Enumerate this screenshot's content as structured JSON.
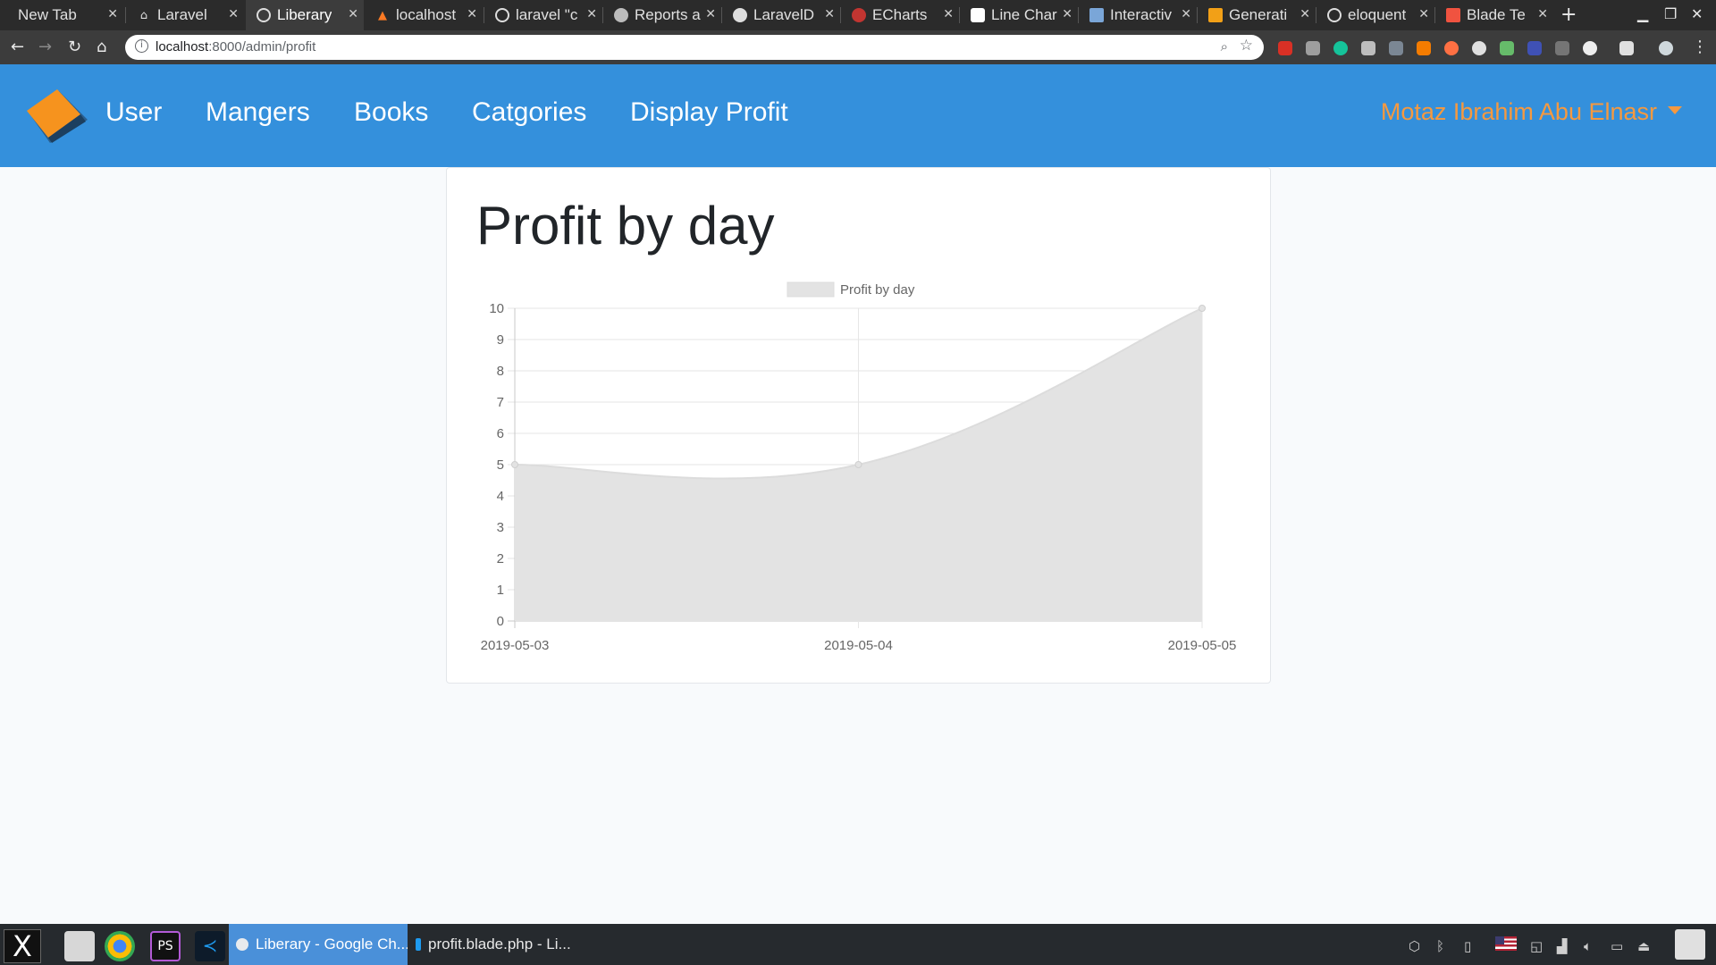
{
  "browser": {
    "tabs": [
      {
        "title": "New Tab",
        "icon": "blank-tab-icon"
      },
      {
        "title": "Laravel",
        "icon": "home-icon"
      },
      {
        "title": "Liberary",
        "icon": "globe-icon",
        "active": true
      },
      {
        "title": "localhost",
        "icon": "xampp-icon"
      },
      {
        "title": "laravel \"c",
        "icon": "google-icon"
      },
      {
        "title": "Reports a",
        "icon": "reports-icon"
      },
      {
        "title": "LaravelD",
        "icon": "github-icon"
      },
      {
        "title": "ECharts",
        "icon": "echarts-icon"
      },
      {
        "title": "Line Char",
        "icon": "line-chart-icon"
      },
      {
        "title": "Interactiv",
        "icon": "interactive-icon"
      },
      {
        "title": "Generati",
        "icon": "generator-icon"
      },
      {
        "title": "eloquent",
        "icon": "google-icon"
      },
      {
        "title": "Blade Te",
        "icon": "laravel-icon"
      }
    ],
    "url_host": "localhost",
    "url_path": ":8000/admin/profit"
  },
  "navbar": {
    "links": [
      "User",
      "Mangers",
      "Books",
      "Catgories",
      "Display Profit"
    ],
    "user_name": "Motaz Ibrahim Abu Elnasr"
  },
  "page": {
    "heading": "Profit by day"
  },
  "chart_data": {
    "type": "area",
    "title": "",
    "x": [
      "2019-05-03",
      "2019-05-04",
      "2019-05-05"
    ],
    "series": [
      {
        "name": "Profit by day",
        "values": [
          5,
          5,
          10
        ]
      }
    ],
    "ylim": [
      0,
      10
    ],
    "yticks": [
      0,
      1,
      2,
      3,
      4,
      5,
      6,
      7,
      8,
      9,
      10
    ],
    "xlabel": "",
    "ylabel": "",
    "grid": true,
    "legend": "top-center",
    "fill_color": "#e3e3e3",
    "line_color": "#dcdcdc"
  },
  "taskbar": {
    "tasks": [
      {
        "label": "Liberary - Google Ch...",
        "active": true
      },
      {
        "label": "profit.blade.php - Li...",
        "active": false
      }
    ]
  },
  "colors": {
    "navbar": "#3490dc",
    "user_accent": "#f6993f"
  }
}
